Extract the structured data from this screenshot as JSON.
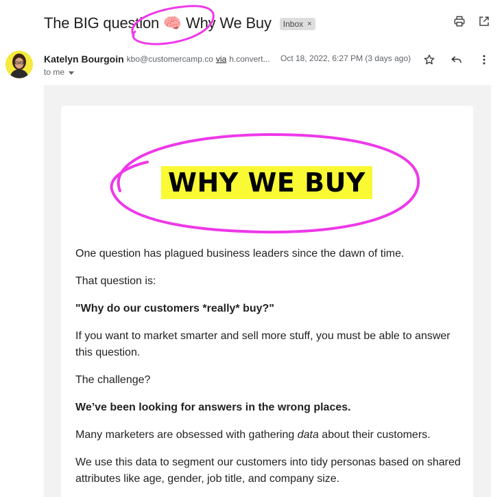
{
  "subject": {
    "text": "The BIG question 🧠 Why We Buy"
  },
  "label": {
    "name": "Inbox",
    "remove": "×"
  },
  "sender": {
    "name": "Katelyn Bourgoin",
    "email": "kbo@customercamp.co",
    "via_label": "via",
    "via_domain": "h.convert...",
    "date": "Oct 18, 2022, 6:27 PM (3 days ago)",
    "to": "to me"
  },
  "icons": {
    "print": "print-icon",
    "open_new_window": "open-in-new-window-icon",
    "star": "star-icon",
    "reply": "reply-icon",
    "more": "more-vert-icon",
    "caret": "chevron-down-icon"
  },
  "colors": {
    "highlight": "#f9f934",
    "annotation": "#ee38e9"
  },
  "body": {
    "logo_text": "WHY WE BUY",
    "p1": "One question has plagued business leaders since the dawn of time.",
    "p2": "That question is:",
    "p3": "\"Why do our customers *really* buy?\"",
    "p4": "If you want to market smarter and sell more stuff, you must be able to answer this question.",
    "p5": "The challenge?",
    "p6": "We’ve been looking for answers in the wrong places.",
    "p7_before": "Many marketers are obsessed with gathering ",
    "p7_em": "data",
    "p7_after": " about their customers.",
    "p8": "We use this data to segment our customers into tidy personas based on shared attributes like age, gender, job title, and company size."
  }
}
